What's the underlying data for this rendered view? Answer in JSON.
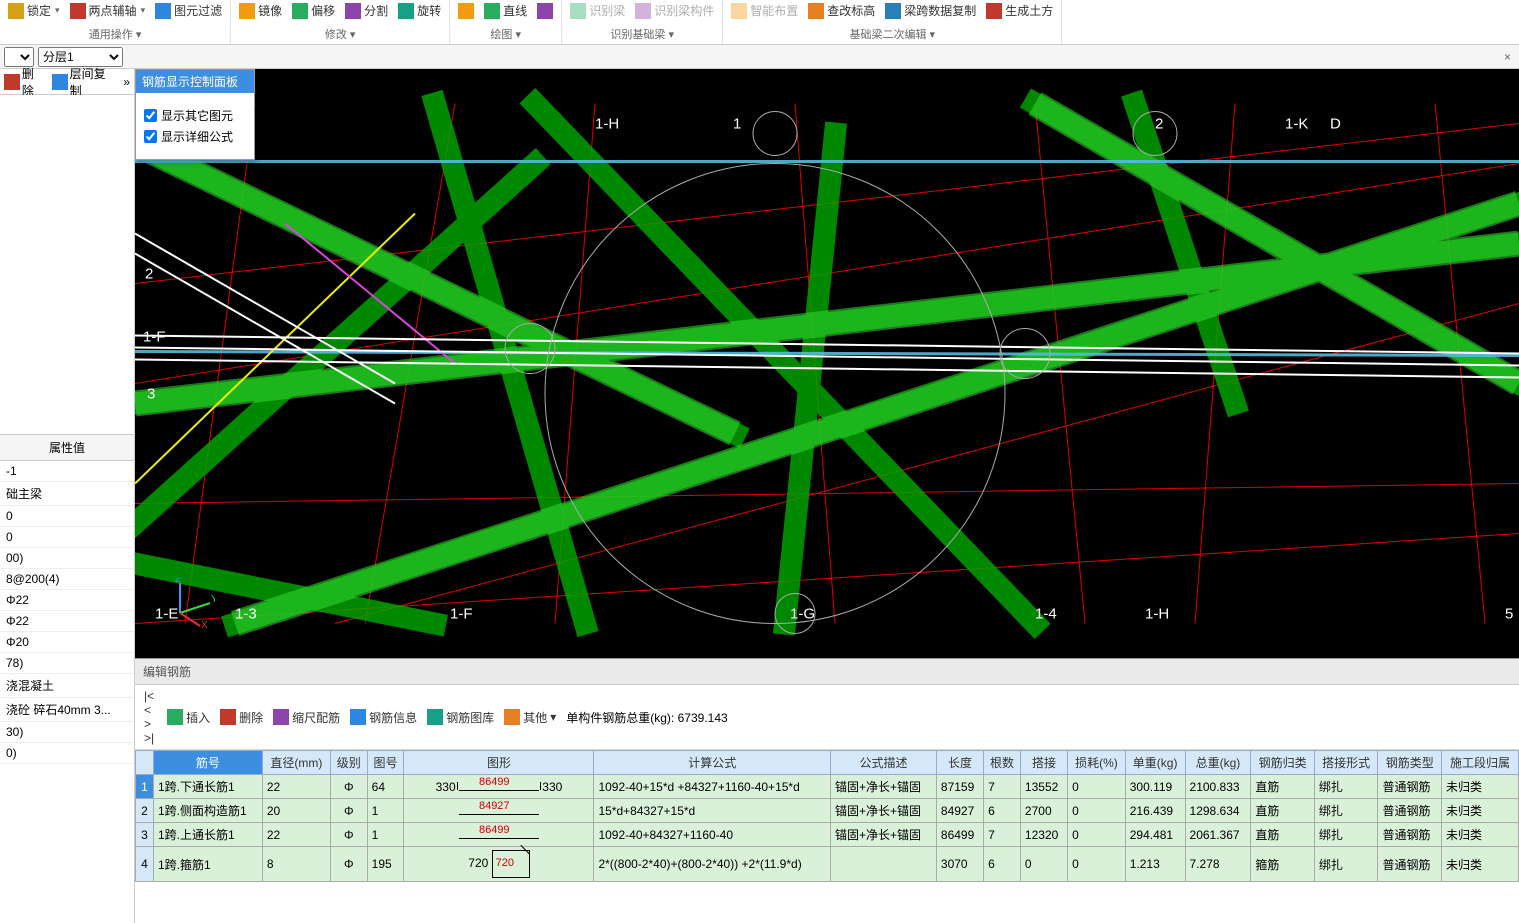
{
  "ribbon": {
    "groups": [
      {
        "label": "通用操作",
        "buttons": [
          {
            "name": "lock-button",
            "text": "锁定",
            "icon": "i-lock",
            "drop": true
          },
          {
            "name": "two-point-axis-button",
            "text": "两点辅轴",
            "icon": "i-axis",
            "drop": true
          },
          {
            "name": "element-filter-button",
            "text": "图元过滤",
            "icon": "i-filter"
          }
        ]
      },
      {
        "label": "修改",
        "buttons": [
          {
            "name": "mirror-button",
            "text": "镜像",
            "icon": "i-mirror"
          },
          {
            "name": "offset-button",
            "text": "偏移",
            "icon": "i-offset"
          },
          {
            "name": "split-button",
            "text": "分割",
            "icon": "i-split"
          },
          {
            "name": "rotate-button",
            "text": "旋转",
            "icon": "i-rotate"
          }
        ]
      },
      {
        "label": "绘图",
        "buttons": [
          {
            "name": "point-btn",
            "text": "",
            "icon": "i-mirror"
          },
          {
            "name": "line-btn",
            "text": "直线",
            "icon": "i-offset"
          },
          {
            "name": "rect-btn",
            "text": "",
            "icon": "i-split"
          }
        ]
      },
      {
        "label": "识别基础梁",
        "buttons": [
          {
            "name": "identify-beam-btn",
            "text": "识别梁",
            "icon": "i-offset",
            "disabled": true
          },
          {
            "name": "identify-component-btn",
            "text": "识别梁构件",
            "icon": "i-split",
            "disabled": true
          }
        ]
      },
      {
        "label": "基础梁二次编辑",
        "buttons": [
          {
            "name": "smart-arrange-btn",
            "text": "智能布置",
            "icon": "i-mirror",
            "disabled": true
          },
          {
            "name": "check-elevation-btn",
            "text": "查改标高",
            "icon": "i-checkh"
          },
          {
            "name": "beam-span-copy-btn",
            "text": "梁跨数据复制",
            "icon": "i-copybeam"
          },
          {
            "name": "gen-earthwork-btn",
            "text": "生成土方",
            "icon": "i-gencube"
          }
        ]
      }
    ]
  },
  "subbar": {
    "layer_selected": "分层1"
  },
  "left_toolbar": {
    "delete": "删除",
    "layer_copy": "层间复制"
  },
  "float_panel": {
    "title": "钢筋显示控制面板",
    "cb1": "显示其它图元",
    "cb2": "显示详细公式"
  },
  "viewport": {
    "grid_labels": [
      "1-H",
      "1",
      "2",
      "1-K",
      "D",
      "2",
      "1-F",
      "3",
      "1-E",
      "1-3",
      "1-F",
      "1-G",
      "1-4",
      "1-H",
      "5"
    ],
    "axes": {
      "x": "X",
      "y": "Y",
      "z": "Z"
    }
  },
  "prop": {
    "header": "属性值",
    "rows": [
      "-1",
      "础主梁",
      "0",
      "0",
      "00)",
      "8@200(4)",
      "Φ22",
      "Φ22",
      "Φ20",
      "78)",
      "浇混凝土",
      "浇砼 碎石40mm 3...",
      "30)",
      "0)"
    ]
  },
  "bottom": {
    "title": "编辑钢筋",
    "toolbar": {
      "nav": [
        "|<",
        "<",
        ">",
        ">|"
      ],
      "insert": "插入",
      "delete": "删除",
      "scale": "缩尺配筋",
      "info": "钢筋信息",
      "lib": "钢筋图库",
      "other": "其他",
      "total_label": "单构件钢筋总重(kg):",
      "total_value": "6739.143"
    },
    "headers": [
      "",
      "筋号",
      "直径(mm)",
      "级别",
      "图号",
      "图形",
      "计算公式",
      "公式描述",
      "长度",
      "根数",
      "搭接",
      "损耗(%)",
      "单重(kg)",
      "总重(kg)",
      "钢筋归类",
      "搭接形式",
      "钢筋类型",
      "施工段归属"
    ],
    "rows": [
      {
        "n": "1",
        "sel": true,
        "name": "1跨.下通长筋1",
        "dia": "22",
        "grade": "Φ",
        "fig": "64",
        "shape_mid": "86499",
        "shape_l": "330",
        "shape_r": "330",
        "formula": "1092-40+15*d +84327+1160-40+15*d",
        "desc": "锚固+净长+锚固",
        "len": "87159",
        "cnt": "7",
        "lap": "13552",
        "loss": "0",
        "uw": "300.119",
        "tw": "2100.833",
        "cat": "直筋",
        "lapf": "绑扎",
        "type": "普通钢筋",
        "seg": "未归类"
      },
      {
        "n": "2",
        "name": "1跨.侧面构造筋1",
        "dia": "20",
        "grade": "Φ",
        "fig": "1",
        "shape_mid": "84927",
        "formula": "15*d+84327+15*d",
        "desc": "锚固+净长+锚固",
        "len": "84927",
        "cnt": "6",
        "lap": "2700",
        "loss": "0",
        "uw": "216.439",
        "tw": "1298.634",
        "cat": "直筋",
        "lapf": "绑扎",
        "type": "普通钢筋",
        "seg": "未归类"
      },
      {
        "n": "3",
        "name": "1跨.上通长筋1",
        "dia": "22",
        "grade": "Φ",
        "fig": "1",
        "shape_mid": "86499",
        "formula": "1092-40+84327+1160-40",
        "desc": "锚固+净长+锚固",
        "len": "86499",
        "cnt": "7",
        "lap": "12320",
        "loss": "0",
        "uw": "294.481",
        "tw": "2061.367",
        "cat": "直筋",
        "lapf": "绑扎",
        "type": "普通钢筋",
        "seg": "未归类"
      },
      {
        "n": "4",
        "name": "1跨.箍筋1",
        "dia": "8",
        "grade": "Φ",
        "fig": "195",
        "shape_mid": "720",
        "shape_box": "720",
        "formula": "2*((800-2*40)+(800-2*40)) +2*(11.9*d)",
        "desc": "",
        "len": "3070",
        "cnt": "6",
        "lap": "0",
        "loss": "0",
        "uw": "1.213",
        "tw": "7.278",
        "cat": "箍筋",
        "lapf": "绑扎",
        "type": "普通钢筋",
        "seg": "未归类"
      }
    ]
  }
}
